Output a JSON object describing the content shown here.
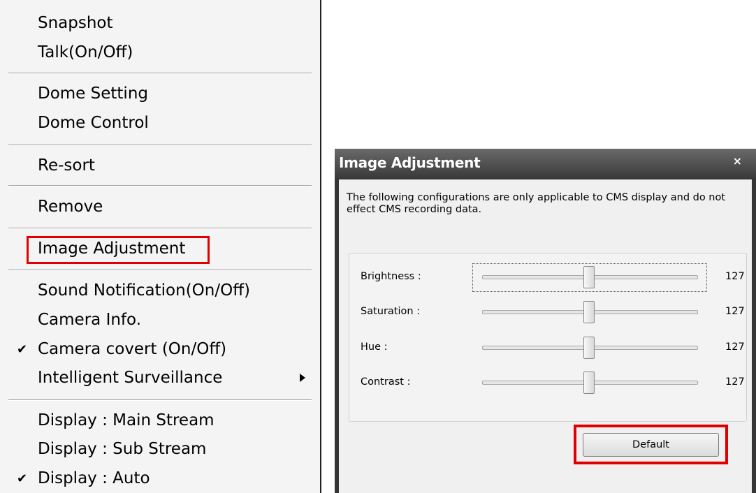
{
  "menu": {
    "items": [
      {
        "label": "Snapshot",
        "checked": false
      },
      {
        "label": "Talk(On/Off)",
        "checked": false
      },
      {
        "label": "Dome Setting",
        "checked": false
      },
      {
        "label": "Dome Control",
        "checked": false
      },
      {
        "label": "Re-sort",
        "checked": false
      },
      {
        "label": "Remove",
        "checked": false
      },
      {
        "label": "Image Adjustment",
        "checked": false,
        "highlighted": true
      },
      {
        "label": "Sound Notification(On/Off)",
        "checked": false
      },
      {
        "label": "Camera Info.",
        "checked": false
      },
      {
        "label": "Camera covert (On/Off)",
        "checked": true
      },
      {
        "label": "Intelligent Surveillance",
        "checked": false,
        "has_submenu": true
      },
      {
        "label": "Display : Main Stream",
        "checked": false
      },
      {
        "label": "Display : Sub Stream",
        "checked": false
      },
      {
        "label": "Display : Auto",
        "checked": true
      }
    ],
    "check_glyph": "✔"
  },
  "dialog": {
    "title": "Image Adjustment",
    "close_glyph": "×",
    "description": "The following configurations are only applicable to CMS display and do not effect CMS recording data.",
    "sliders": [
      {
        "label": "Brightness :",
        "value": "127"
      },
      {
        "label": "Saturation :",
        "value": "127"
      },
      {
        "label": "Hue :",
        "value": "127"
      },
      {
        "label": "Contrast :",
        "value": "127"
      }
    ],
    "default_button": "Default"
  },
  "colors": {
    "highlight": "#e00000",
    "titlebar": "#3a3a3a"
  }
}
